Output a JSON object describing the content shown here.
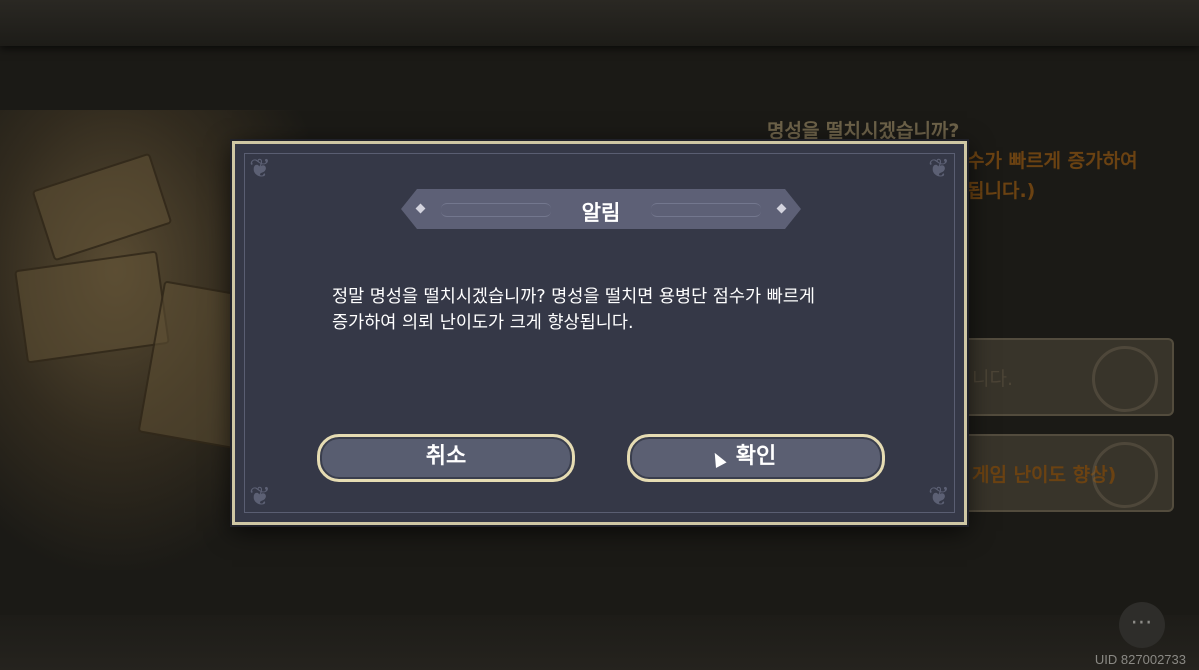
{
  "dialog": {
    "title": "알림",
    "message_line1": "정말 명성을 떨치시겠습니까? 명성을 떨치면 용병단 점수가 빠르게",
    "message_line2": "증가하여 의뢰 난이도가 크게 향상됩니다.",
    "cancel_label": "취소",
    "confirm_label": "확인"
  },
  "background": {
    "title": "명성을 떨치시겠습니까?",
    "subtitle_line1": "수가 빠르게 증가하여",
    "subtitle_line2": "됩니다.)",
    "option1_text": "니다.",
    "option2_text": "게임 난이도 향상)",
    "more_icon": "⋯",
    "uid": "UID 827002733"
  },
  "colors": {
    "dialog_bg": "#353847",
    "dialog_border": "#cfc7a4",
    "title_plate": "#5d6076",
    "button_bg": "#585d70"
  },
  "icons": [
    "corner-ornament-icon",
    "diamond-icon",
    "more-icon",
    "cursor-icon"
  ]
}
